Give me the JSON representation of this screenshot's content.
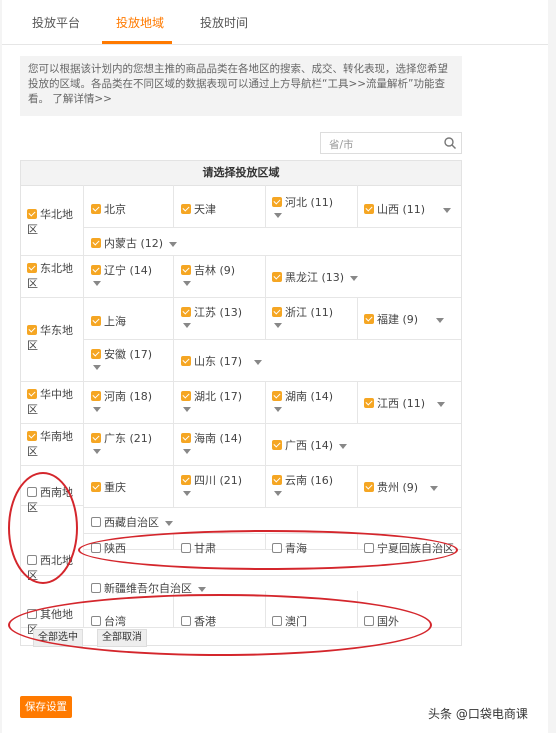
{
  "tabs": [
    {
      "label": "投放平台",
      "active": false
    },
    {
      "label": "投放地域",
      "active": true
    },
    {
      "label": "投放时间",
      "active": false
    }
  ],
  "notice": "您可以根据该计划内的您想主推的商品品类在各地区的搜索、成交、转化表现，选择您希望投放的区域。各品类在不同区域的数据表现可以通过上方导航栏“工具>>流量解析”功能查看。 了解详情>>",
  "search": {
    "placeholder": "省/市"
  },
  "grid": {
    "title": "请选择投放区域"
  },
  "regions": [
    {
      "name": "华北地区",
      "checked": true
    },
    {
      "name": "东北地区",
      "checked": true
    },
    {
      "name": "华东地区",
      "checked": true
    },
    {
      "name": "华中地区",
      "checked": true
    },
    {
      "name": "华南地区",
      "checked": true
    },
    {
      "name": "西南地区",
      "checked": false
    },
    {
      "name": "西北地区",
      "checked": false
    },
    {
      "name": "其他地区",
      "checked": false
    }
  ],
  "provinces": [
    {
      "label": "北京",
      "checked": true
    },
    {
      "label": "天津",
      "checked": true
    },
    {
      "label": "河北 (11)",
      "checked": true
    },
    {
      "label": "山西 (11)",
      "checked": true
    },
    {
      "label": "内蒙古 (12)",
      "checked": true
    },
    {
      "label": "辽宁 (14)",
      "checked": true
    },
    {
      "label": "吉林 (9)",
      "checked": true
    },
    {
      "label": "黑龙江 (13)",
      "checked": true
    },
    {
      "label": "上海",
      "checked": true
    },
    {
      "label": "江苏 (13)",
      "checked": true
    },
    {
      "label": "浙江 (11)",
      "checked": true
    },
    {
      "label": "福建 (9)",
      "checked": true
    },
    {
      "label": "安徽 (17)",
      "checked": true
    },
    {
      "label": "山东 (17)",
      "checked": true
    },
    {
      "label": "河南 (18)",
      "checked": true
    },
    {
      "label": "湖北 (17)",
      "checked": true
    },
    {
      "label": "湖南 (14)",
      "checked": true
    },
    {
      "label": "江西 (11)",
      "checked": true
    },
    {
      "label": "广东 (21)",
      "checked": true
    },
    {
      "label": "海南 (14)",
      "checked": true
    },
    {
      "label": "广西 (14)",
      "checked": true
    },
    {
      "label": "重庆",
      "checked": true
    },
    {
      "label": "四川 (21)",
      "checked": true
    },
    {
      "label": "云南 (16)",
      "checked": true
    },
    {
      "label": "贵州 (9)",
      "checked": true
    },
    {
      "label": "西藏自治区",
      "checked": false
    },
    {
      "label": "陕西",
      "checked": false
    },
    {
      "label": "甘肃",
      "checked": false
    },
    {
      "label": "青海",
      "checked": false
    },
    {
      "label": "宁夏回族自治区",
      "checked": false
    },
    {
      "label": "新疆维吾尔自治区",
      "checked": false
    },
    {
      "label": "台湾",
      "checked": false
    },
    {
      "label": "香港",
      "checked": false
    },
    {
      "label": "澳门",
      "checked": false
    },
    {
      "label": "国外",
      "checked": false
    }
  ],
  "actions": {
    "select_all": "全部选中",
    "deselect_all": "全部取消",
    "save": "保存设置"
  },
  "watermark": "头条 @口袋电商课",
  "colors": {
    "accent": "#ff7a00",
    "checkbox": "#f5a623",
    "annotation": "#d4262c"
  }
}
